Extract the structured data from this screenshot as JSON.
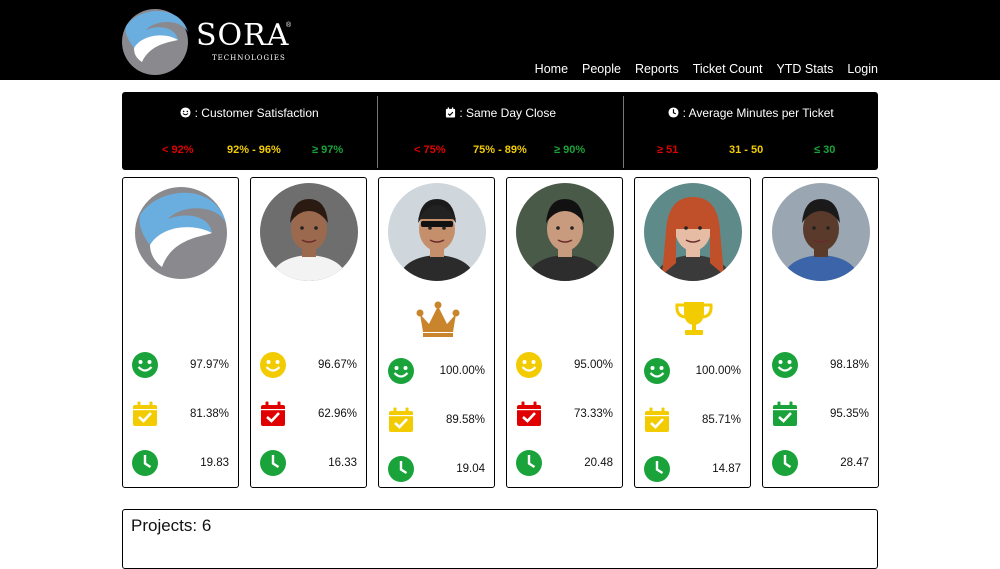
{
  "brand": {
    "name": "SORA",
    "registered": "®",
    "sub": "TECHNOLOGIES"
  },
  "nav": [
    "Home",
    "People",
    "Reports",
    "Ticket Count",
    "YTD Stats",
    "Login"
  ],
  "kpis": [
    {
      "title": ": Customer Satisfaction",
      "icon": "smiley-icon",
      "low": "< 92%",
      "mid": "92% - 96%",
      "high": "≥ 97%"
    },
    {
      "title": ": Same Day Close",
      "icon": "calendar-check-icon",
      "low": "< 75%",
      "mid": "75% - 89%",
      "high": "≥ 90%"
    },
    {
      "title": ": Average Minutes per Ticket",
      "icon": "clock-icon",
      "low": "≥ 51",
      "mid": "31 - 50",
      "high": "≤ 30"
    }
  ],
  "colors": {
    "red": "#e00000",
    "yellow": "#f2cc00",
    "green": "#1aa33a"
  },
  "people": [
    {
      "avatar": "company-logo",
      "award": "",
      "satisfaction": "97.97%",
      "sat_status": "green",
      "same_day": "81.38%",
      "sd_status": "yellow",
      "minutes": "19.83",
      "min_status": "green"
    },
    {
      "avatar": "person",
      "award": "",
      "satisfaction": "96.67%",
      "sat_status": "yellow",
      "same_day": "62.96%",
      "sd_status": "red",
      "minutes": "16.33",
      "min_status": "green"
    },
    {
      "avatar": "person",
      "award": "crown-icon",
      "satisfaction": "100.00%",
      "sat_status": "green",
      "same_day": "89.58%",
      "sd_status": "yellow",
      "minutes": "19.04",
      "min_status": "green"
    },
    {
      "avatar": "person",
      "award": "",
      "satisfaction": "95.00%",
      "sat_status": "yellow",
      "same_day": "73.33%",
      "sd_status": "red",
      "minutes": "20.48",
      "min_status": "green"
    },
    {
      "avatar": "person",
      "award": "trophy-icon",
      "satisfaction": "100.00%",
      "sat_status": "green",
      "same_day": "85.71%",
      "sd_status": "yellow",
      "minutes": "14.87",
      "min_status": "green"
    },
    {
      "avatar": "person",
      "award": "",
      "satisfaction": "98.18%",
      "sat_status": "green",
      "same_day": "95.35%",
      "sd_status": "green",
      "minutes": "28.47",
      "min_status": "green"
    }
  ],
  "projects": {
    "label": "Projects:",
    "count": "6"
  }
}
